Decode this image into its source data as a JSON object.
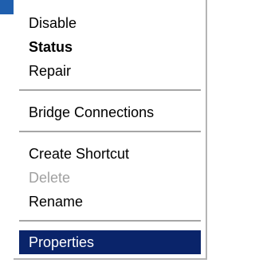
{
  "context_menu": {
    "items": [
      {
        "label": "Disable"
      },
      {
        "label": "Status"
      },
      {
        "label": "Repair"
      },
      {
        "label": "Bridge Connections"
      },
      {
        "label": "Create Shortcut"
      },
      {
        "label": "Delete"
      },
      {
        "label": "Rename"
      },
      {
        "label": "Properties"
      }
    ],
    "bold_item": "Status",
    "disabled_item": "Delete",
    "selected_item": "Properties"
  },
  "colors": {
    "highlight": "#0a246a",
    "highlight_text": "#ffffff",
    "disabled_text": "#a0a0a0",
    "separator": "#a6a6a6",
    "corner_accent": "#1f5fae"
  }
}
